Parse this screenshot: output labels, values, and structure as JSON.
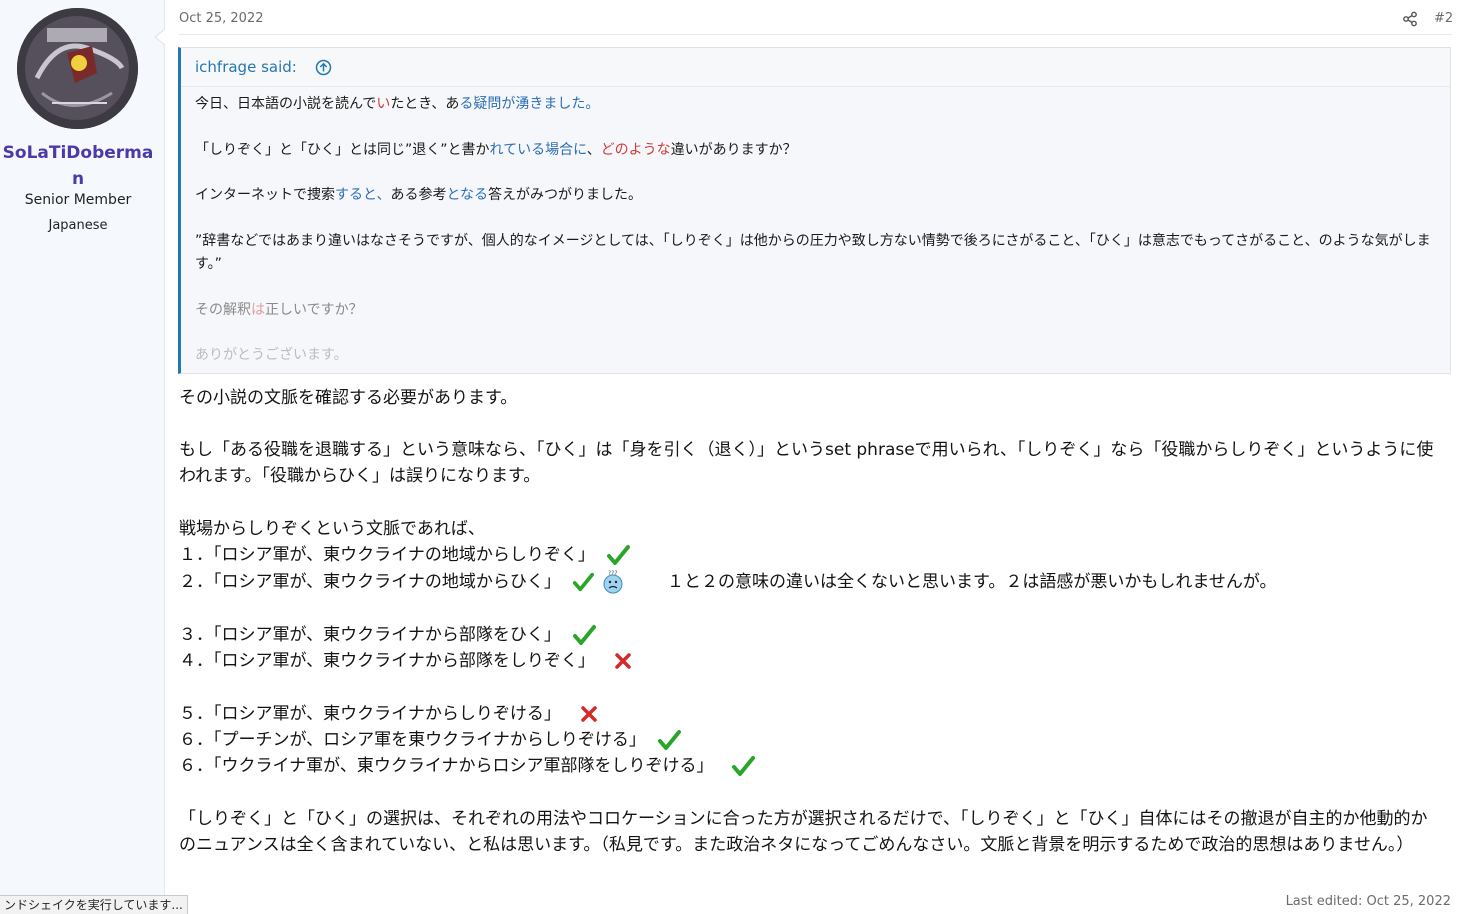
{
  "user": {
    "name_line1": "SoLaTiDoberma",
    "name_line2": "n",
    "title": "Senior Member",
    "language": "Japanese"
  },
  "post": {
    "date": "Oct 25, 2022",
    "number": "#2",
    "last_edited": "Last edited: Oct 25, 2022"
  },
  "quote": {
    "author": "ichfrage said:",
    "p1": {
      "a": "今日、日本語の小説を読んで",
      "b": "い",
      "c": "たとき、あ",
      "d": "る疑問が湧きました。"
    },
    "p2": {
      "a": "「しりぞく」と「ひく」とは同じ”退く”と書か",
      "b": "れている場合に",
      "c": "、",
      "d": "どのような",
      "e": "違いがありますか？"
    },
    "p3": {
      "a": "インターネットで捜索",
      "b": "すると、",
      "c": "ある参考",
      "d": "となる",
      "e": "答えがみつがりました。"
    },
    "p4": "”辞書などではあまり違いはなさそうですが、個人的なイメージとしては、「しりぞく」は他からの圧力や致し方ない情勢で後ろにさがること、「ひく」は意志でもってさがること、のような気がします。”",
    "p5": {
      "a": "その解釈",
      "b": "は",
      "c": "正しいですか？"
    },
    "p6": "ありがとうございます。"
  },
  "body": {
    "p1": "その小説の文脈を確認する必要があります。",
    "p2": "もし「ある役職を退職する」という意味なら、「ひく」は「身を引く（退く）」というset phraseで用いられ、「しりぞく」なら「役職からしりぞく」というように使われます。「役職からひく」は誤りになります。",
    "p3": "戦場からしりぞくという文脈であれば、",
    "line1": "１．「ロシア軍が、東ウクライナの地域からしりぞく」",
    "line2": "２．「ロシア軍が、東ウクライナの地域からひく」",
    "line2_note": "１と２の意味の違いは全くないと思います。２は語感が悪いかもしれませんが。",
    "line3": "３．「ロシア軍が、東ウクライナから部隊をひく」",
    "line4": "４．「ロシア軍が、東ウクライナから部隊をしりぞく」",
    "line5": "５．「ロシア軍が、東ウクライナからしりぞける」",
    "line6": "６．「プーチンが、ロシア軍を東ウクライナからしりぞける」",
    "line7": "６．「ウクライナ軍が、東ウクライナからロシア軍部隊をしりぞける」",
    "p4": "「しりぞく」と「ひく」の選択は、それぞれの用法やコロケーションに合った方が選択されるだけで、「しりぞく」と「ひく」自体にはその撤退が自主的か他動的かのニュアンスは全く含まれていない、と私は思います。（私見です。また政治ネタになってごめんなさい。文脈と背景を明示するためで政治的思想はありません。）"
  },
  "status_bar": "ンドシェイクを実行しています...",
  "icons": {
    "share": "share-icon",
    "quote_jump": "arrow-up-circle-icon",
    "check": "check-icon",
    "cross": "cross-icon",
    "emoji": "confused-face-icon"
  },
  "colors": {
    "accent": "#2577b1",
    "username": "#4c3aa8",
    "check": "#2aa52a",
    "cross": "#d42a2a"
  }
}
